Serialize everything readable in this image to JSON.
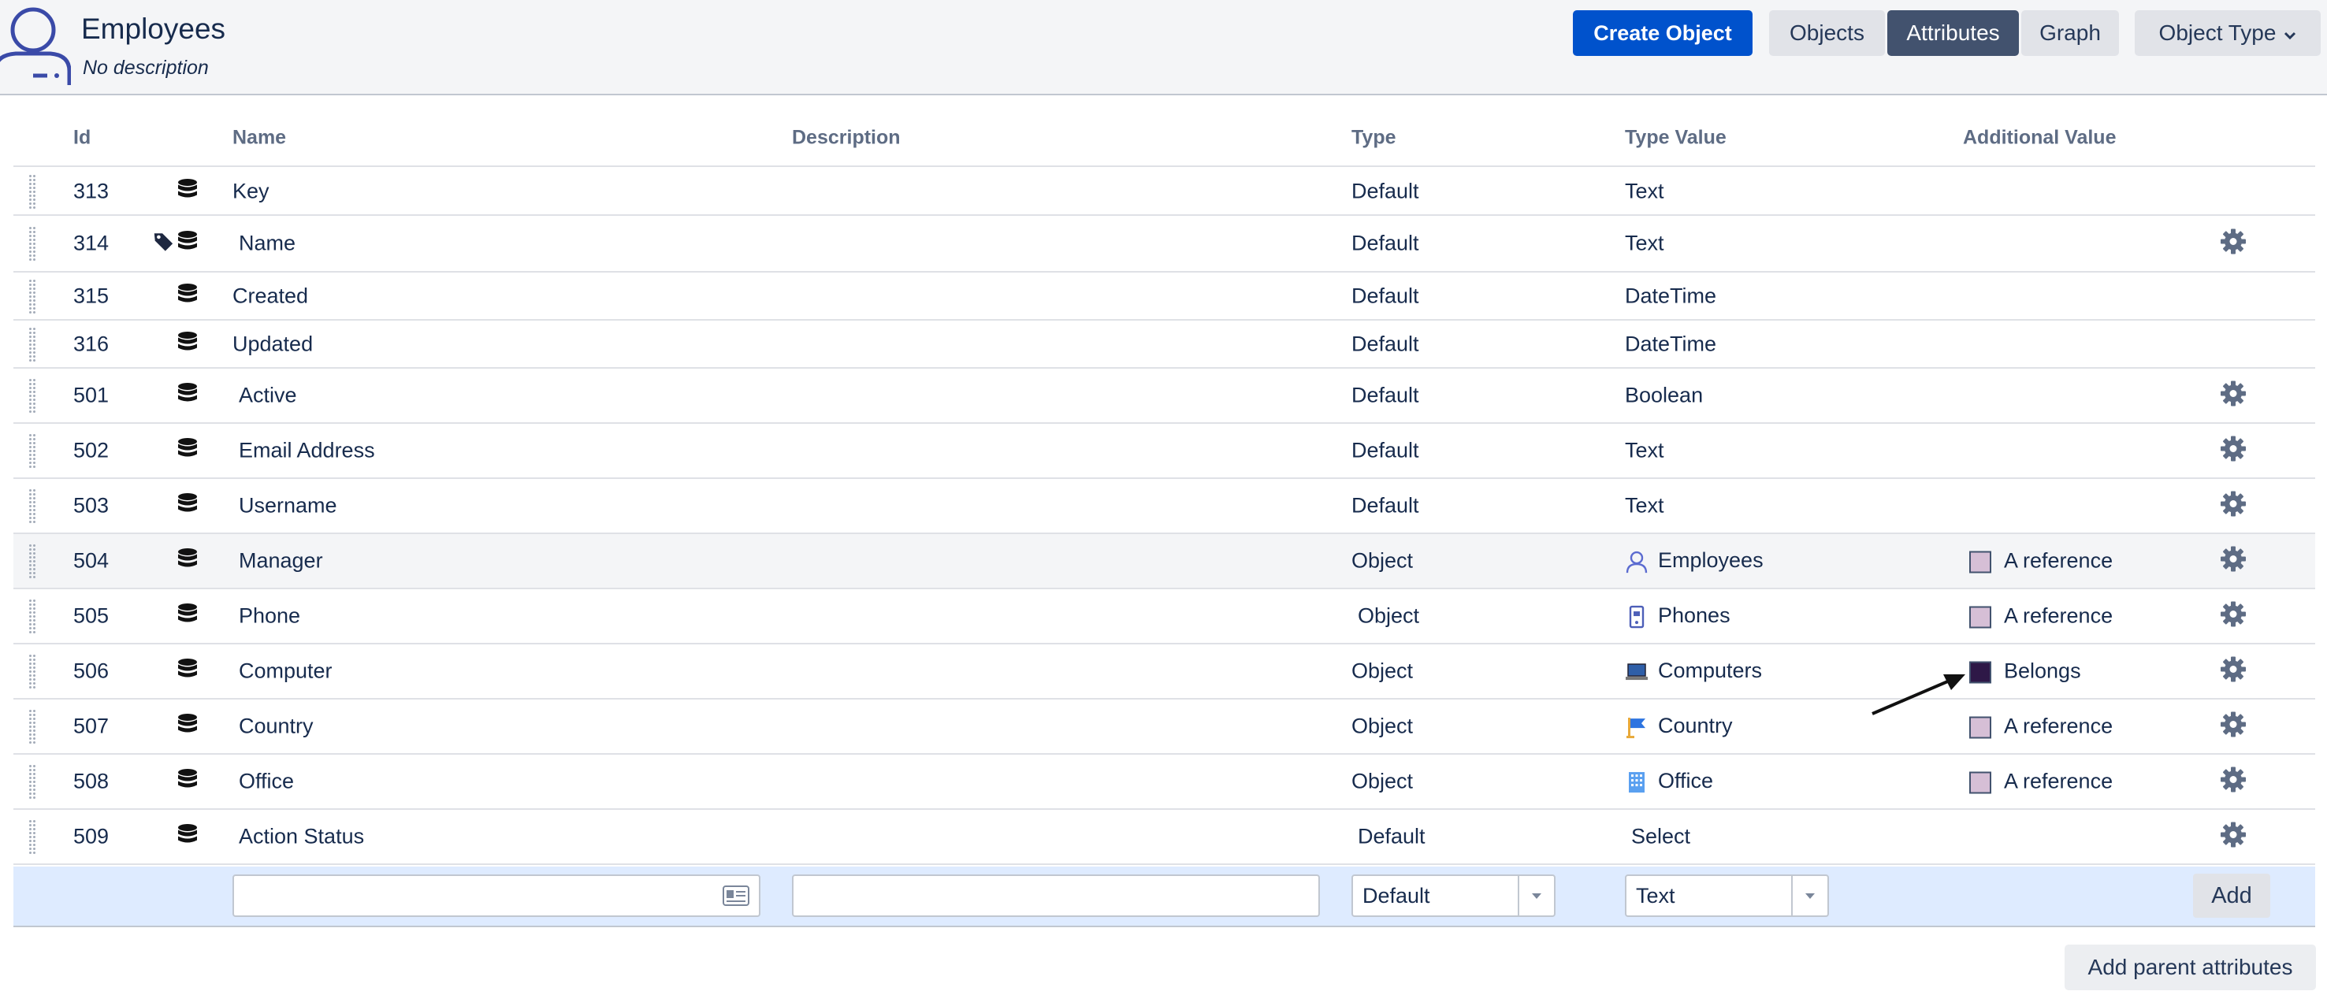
{
  "header": {
    "title": "Employees",
    "subtitle": "No description",
    "buttons": {
      "create": "Create Object",
      "objects": "Objects",
      "attributes": "Attributes",
      "graph": "Graph",
      "object_type": "Object Type"
    }
  },
  "columns": {
    "id": "Id",
    "name": "Name",
    "description": "Description",
    "type": "Type",
    "type_value": "Type Value",
    "additional_value": "Additional Value"
  },
  "rows": [
    {
      "id": "313",
      "name": "Key",
      "type": "Default",
      "type_value": "Text",
      "additional": "",
      "gear": false,
      "label": false,
      "type_icon": "",
      "swatch": ""
    },
    {
      "id": "314",
      "name": "Name",
      "type": "Default",
      "type_value": "Text",
      "additional": "",
      "gear": true,
      "label": true,
      "type_icon": "",
      "swatch": ""
    },
    {
      "id": "315",
      "name": "Created",
      "type": "Default",
      "type_value": "DateTime",
      "additional": "",
      "gear": false,
      "label": false,
      "type_icon": "",
      "swatch": ""
    },
    {
      "id": "316",
      "name": "Updated",
      "type": "Default",
      "type_value": "DateTime",
      "additional": "",
      "gear": false,
      "label": false,
      "type_icon": "",
      "swatch": ""
    },
    {
      "id": "501",
      "name": "Active",
      "type": "Default",
      "type_value": "Boolean",
      "additional": "",
      "gear": true,
      "label": false,
      "type_icon": "",
      "swatch": ""
    },
    {
      "id": "502",
      "name": "Email Address",
      "type": "Default",
      "type_value": "Text",
      "additional": "",
      "gear": true,
      "label": false,
      "type_icon": "",
      "swatch": ""
    },
    {
      "id": "503",
      "name": "Username",
      "type": "Default",
      "type_value": "Text",
      "additional": "",
      "gear": true,
      "label": false,
      "type_icon": "",
      "swatch": ""
    },
    {
      "id": "504",
      "name": "Manager",
      "type": "Object",
      "type_value": "Employees",
      "additional": "A reference",
      "gear": true,
      "label": false,
      "type_icon": "person-icon",
      "swatch": "#d6bfd6"
    },
    {
      "id": "505",
      "name": "Phone",
      "type": "Object",
      "type_value": "Phones",
      "additional": "A reference",
      "gear": true,
      "label": false,
      "type_icon": "phone-icon",
      "swatch": "#d6bfd6"
    },
    {
      "id": "506",
      "name": "Computer",
      "type": "Object",
      "type_value": "Computers",
      "additional": "Belongs",
      "gear": true,
      "label": false,
      "type_icon": "laptop-icon",
      "swatch": "#2e1847"
    },
    {
      "id": "507",
      "name": "Country",
      "type": "Object",
      "type_value": "Country",
      "additional": "A reference",
      "gear": true,
      "label": false,
      "type_icon": "flag-icon",
      "swatch": "#d6bfd6"
    },
    {
      "id": "508",
      "name": "Office",
      "type": "Object",
      "type_value": "Office",
      "additional": "A reference",
      "gear": true,
      "label": false,
      "type_icon": "building-icon",
      "swatch": "#d6bfd6"
    },
    {
      "id": "509",
      "name": "Action Status",
      "type": "Default",
      "type_value": "Select",
      "additional": "",
      "gear": true,
      "label": false,
      "type_icon": "",
      "swatch": ""
    }
  ],
  "add_form": {
    "name_value": "",
    "description_value": "",
    "type_selected": "Default",
    "type_value_selected": "Text",
    "add_label": "Add"
  },
  "footer": {
    "add_parent_label": "Add parent attributes"
  },
  "colors": {
    "primary": "#0052cc",
    "selected_tab": "#42526e",
    "add_row_bg": "#deebff",
    "highlight_row": "#f4f5f7"
  }
}
